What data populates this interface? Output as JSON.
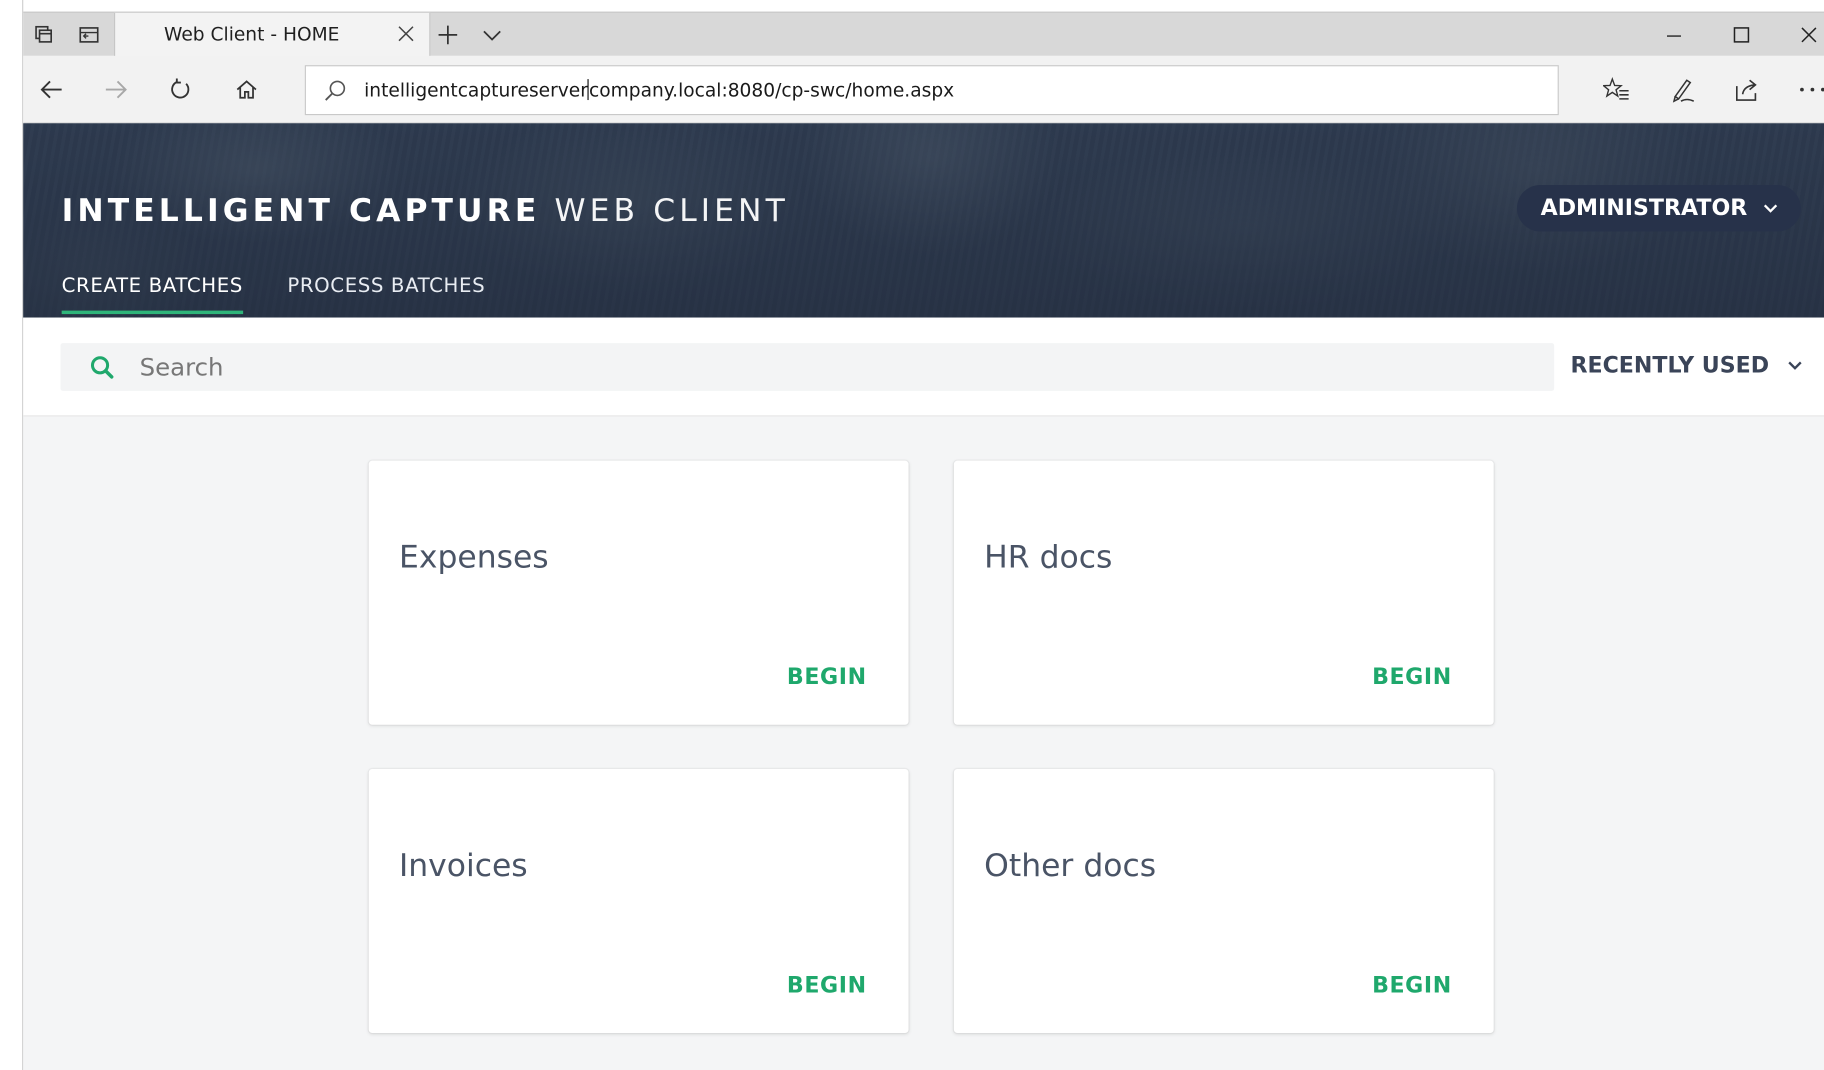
{
  "browser": {
    "tab_title": "Web Client - HOME",
    "url_prefix": "intelligentcaptureserver",
    "url_suffix": "company.local:8080/cp-swc/home.aspx"
  },
  "app": {
    "brand_strong": "INTELLIGENT CAPTURE",
    "brand_light": "WEB CLIENT",
    "user_label": "ADMINISTRATOR",
    "tabs": [
      {
        "label": "CREATE BATCHES",
        "active": true
      },
      {
        "label": "PROCESS BATCHES",
        "active": false
      }
    ],
    "accent_color": "#1fa86c"
  },
  "filter": {
    "search_placeholder": "Search",
    "sort_label": "RECENTLY USED"
  },
  "cards": [
    {
      "title": "Expenses",
      "action": "BEGIN"
    },
    {
      "title": "HR docs",
      "action": "BEGIN"
    },
    {
      "title": "Invoices",
      "action": "BEGIN"
    },
    {
      "title": "Other docs",
      "action": "BEGIN"
    }
  ]
}
